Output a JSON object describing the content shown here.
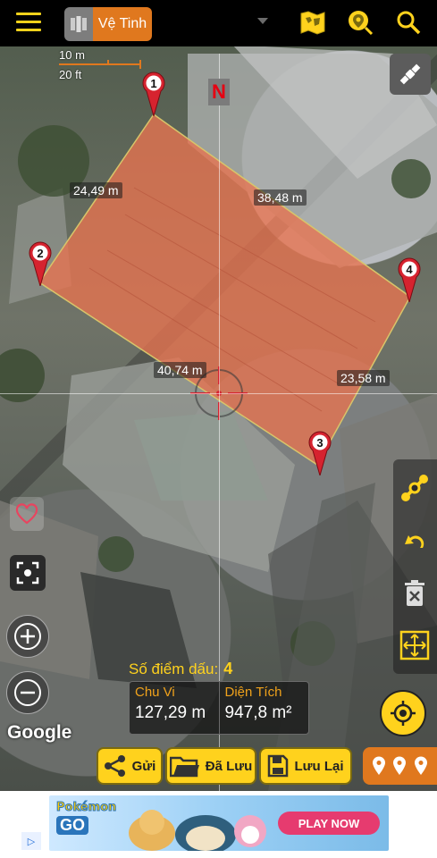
{
  "topbar": {
    "map_mode_label": "Vệ Tinh",
    "icons": [
      "menu-icon",
      "map-layers-icon",
      "world-map-icon",
      "location-search-icon",
      "search-icon"
    ]
  },
  "scale": {
    "metric": "10 m",
    "imperial": "20 ft"
  },
  "compass": {
    "north_label": "N"
  },
  "markers": [
    "1",
    "2",
    "3",
    "4"
  ],
  "distances": {
    "side_1_2": "24,49 m",
    "side_1_4": "38,48 m",
    "side_2_3": "40,74 m",
    "side_4_3": "23,58 m"
  },
  "measure": {
    "points_label": "Số điểm dấu:",
    "points_count": "4",
    "perimeter_label": "Chu Vi",
    "perimeter_value": "127,29 m",
    "area_label": "Diện Tích",
    "area_value": "947,8 m²"
  },
  "map_attribution": "Google",
  "bottom_bar": {
    "send_label": "Gửi",
    "saved_label": "Đã Lưu",
    "save_label": "Lưu Lại"
  },
  "ad": {
    "brand": "Pokémon",
    "sub": "GO",
    "cta": "PLAY NOW"
  },
  "colors": {
    "accent_yellow": "#ffd21d",
    "accent_orange": "#e0781e",
    "polygon_fill": "#e8734f",
    "marker_red": "#d6232f"
  }
}
